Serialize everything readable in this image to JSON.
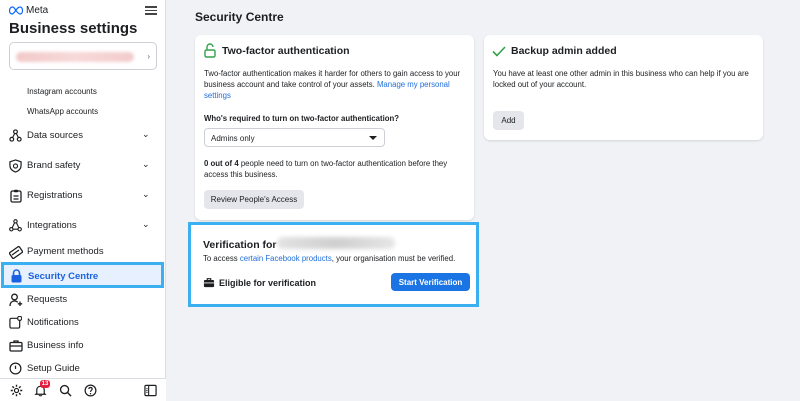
{
  "sidebar": {
    "brand": "Meta",
    "title": "Business settings",
    "sub_items": [
      {
        "label": "Instagram accounts"
      },
      {
        "label": "WhatsApp accounts"
      }
    ],
    "items": [
      {
        "label": "Data sources",
        "icon": "data-sources-icon"
      },
      {
        "label": "Brand safety",
        "icon": "shield-icon"
      },
      {
        "label": "Registrations",
        "icon": "clipboard-icon"
      },
      {
        "label": "Integrations",
        "icon": "integrations-icon"
      },
      {
        "label": "Payment methods",
        "icon": "card-icon"
      },
      {
        "label": "Security Centre",
        "icon": "lock-icon"
      },
      {
        "label": "Requests",
        "icon": "person-add-icon"
      },
      {
        "label": "Notifications",
        "icon": "notifications-icon"
      },
      {
        "label": "Business info",
        "icon": "briefcase-icon"
      },
      {
        "label": "Setup Guide",
        "icon": "guide-icon"
      }
    ],
    "notification_count": "13"
  },
  "main": {
    "page_title": "Security Centre",
    "two_factor": {
      "heading": "Two-factor authentication",
      "description": "Two-factor authentication makes it harder for others to gain access to your business account and take control of your assets.",
      "manage_link": "Manage my personal settings",
      "question": "Who's required to turn on two-factor authentication?",
      "dropdown_value": "Admins only",
      "status_bold": "0 out of 4",
      "status_rest": " people need to turn on two-factor authentication before they access this business.",
      "review_button": "Review People's Access"
    },
    "backup_admin": {
      "heading": "Backup admin added",
      "description": "You have at least one other admin in this business who can help if you are locked out of your account.",
      "add_button": "Add"
    },
    "verification": {
      "heading": "Verification for",
      "text_prefix": "To access ",
      "link": "certain Facebook products",
      "text_suffix": ", your organisation must be verified.",
      "eligible": "Eligible for verification",
      "start_button": "Start Verification"
    }
  },
  "colors": {
    "accent": "#1b74e4",
    "highlight": "#3ab0f0",
    "success": "#31a24c"
  }
}
